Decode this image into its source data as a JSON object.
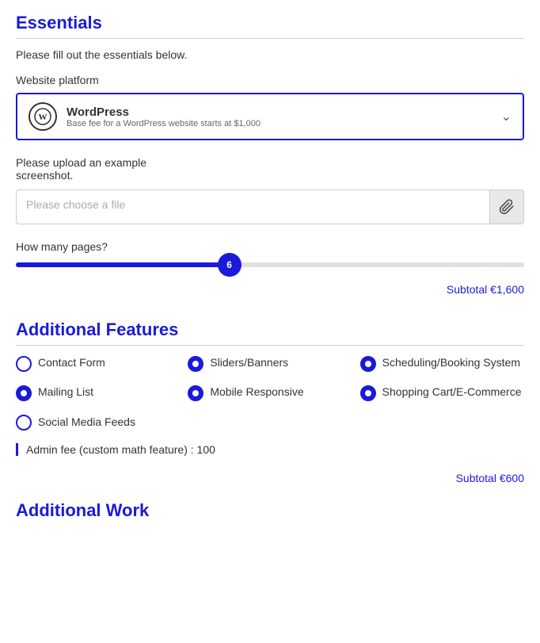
{
  "essentials": {
    "title": "Essentials",
    "subtitle": "Please fill out the essentials below.",
    "platform": {
      "label": "Website platform",
      "name": "WordPress",
      "description": "Base fee for a WordPress website starts at $1,000",
      "logo_text": "W"
    },
    "upload": {
      "label_line1": "Please upload an example",
      "label_line2": "screenshot.",
      "placeholder": "Please choose a file",
      "attach_icon": "📎"
    },
    "pages": {
      "label": "How many pages?",
      "value": 6,
      "fill_percent": 42
    },
    "subtotal_label": "Subtotal",
    "subtotal_value": "€1,600"
  },
  "additional_features": {
    "title": "Additional Features",
    "features": [
      {
        "label": "Contact Form",
        "checked": false
      },
      {
        "label": "Sliders/Banners",
        "checked": true
      },
      {
        "label": "Scheduling/Booking System",
        "checked": true
      },
      {
        "label": "Mailing List",
        "checked": true
      },
      {
        "label": "Mobile Responsive",
        "checked": true
      },
      {
        "label": "Shopping Cart/E-Commerce",
        "checked": true
      }
    ],
    "social_media": {
      "label": "Social Media Feeds",
      "checked": false
    },
    "admin_fee": {
      "text": "Admin fee (custom math feature) : 100"
    },
    "subtotal_label": "Subtotal",
    "subtotal_value": "€600"
  },
  "additional_work": {
    "title": "Additional Work"
  }
}
